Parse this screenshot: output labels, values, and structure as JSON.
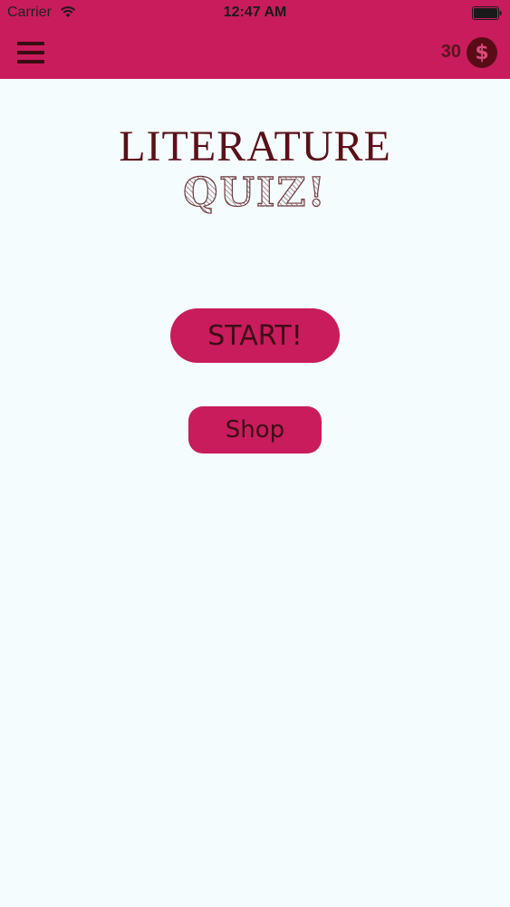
{
  "status_bar": {
    "carrier": "Carrier",
    "time": "12:47 AM",
    "wifi_icon": "wifi-icon",
    "battery_icon": "battery-icon"
  },
  "nav": {
    "menu_icon": "hamburger-menu-icon",
    "coins": "30",
    "coin_symbol": "$",
    "coin_icon": "coin-icon"
  },
  "title": {
    "line1": "LITERATURE",
    "line2": "QUIZ!"
  },
  "buttons": {
    "start": "START!",
    "shop": "Shop"
  },
  "colors": {
    "accent": "#c91c5c",
    "dark_text": "#5a1019",
    "background": "#f5fcfe"
  }
}
